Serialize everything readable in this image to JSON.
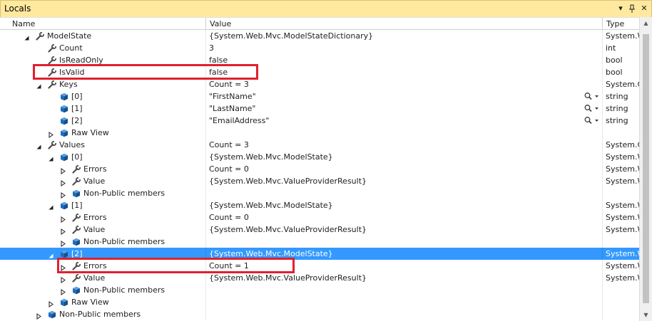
{
  "window": {
    "title": "Locals",
    "dropdown_glyph": "▾",
    "pin_glyph": "ᵖ",
    "close_glyph": "✕"
  },
  "columns": {
    "name": "Name",
    "value": "Value",
    "type": "Type"
  },
  "rows": [
    {
      "level": 2,
      "expander": "expanded",
      "icon": "wrench",
      "name": "ModelState",
      "value": "{System.Web.Mvc.ModelStateDictionary}",
      "type": "System.W",
      "magnifier": false,
      "selected": false
    },
    {
      "level": 3,
      "expander": "none",
      "icon": "wrench",
      "name": "Count",
      "value": "3",
      "type": "int",
      "magnifier": false,
      "selected": false
    },
    {
      "level": 3,
      "expander": "none",
      "icon": "wrench",
      "name": "IsReadOnly",
      "value": "false",
      "type": "bool",
      "magnifier": false,
      "selected": false
    },
    {
      "level": 3,
      "expander": "none",
      "icon": "wrench",
      "name": "IsValid",
      "value": "false",
      "type": "bool",
      "magnifier": false,
      "selected": false
    },
    {
      "level": 3,
      "expander": "expanded",
      "icon": "wrench",
      "name": "Keys",
      "value": "Count = 3",
      "type": "System.C",
      "magnifier": false,
      "selected": false
    },
    {
      "level": 4,
      "expander": "none",
      "icon": "cube",
      "name": "[0]",
      "value": "\"FirstName\"",
      "type": "string",
      "magnifier": true,
      "selected": false
    },
    {
      "level": 4,
      "expander": "none",
      "icon": "cube",
      "name": "[1]",
      "value": "\"LastName\"",
      "type": "string",
      "magnifier": true,
      "selected": false
    },
    {
      "level": 4,
      "expander": "none",
      "icon": "cube",
      "name": "[2]",
      "value": "\"EmailAddress\"",
      "type": "string",
      "magnifier": true,
      "selected": false
    },
    {
      "level": 4,
      "expander": "collapsed",
      "icon": "cube",
      "name": "Raw View",
      "value": "",
      "type": "",
      "magnifier": false,
      "selected": false
    },
    {
      "level": 3,
      "expander": "expanded",
      "icon": "wrench",
      "name": "Values",
      "value": "Count = 3",
      "type": "System.C",
      "magnifier": false,
      "selected": false
    },
    {
      "level": 4,
      "expander": "expanded",
      "icon": "cube",
      "name": "[0]",
      "value": "{System.Web.Mvc.ModelState}",
      "type": "System.W",
      "magnifier": false,
      "selected": false
    },
    {
      "level": 5,
      "expander": "collapsed",
      "icon": "wrench",
      "name": "Errors",
      "value": "Count = 0",
      "type": "System.W",
      "magnifier": false,
      "selected": false
    },
    {
      "level": 5,
      "expander": "collapsed",
      "icon": "wrench",
      "name": "Value",
      "value": "{System.Web.Mvc.ValueProviderResult}",
      "type": "System.W",
      "magnifier": false,
      "selected": false
    },
    {
      "level": 5,
      "expander": "collapsed",
      "icon": "cube",
      "name": "Non-Public members",
      "value": "",
      "type": "",
      "magnifier": false,
      "selected": false
    },
    {
      "level": 4,
      "expander": "expanded",
      "icon": "cube",
      "name": "[1]",
      "value": "{System.Web.Mvc.ModelState}",
      "type": "System.W",
      "magnifier": false,
      "selected": false
    },
    {
      "level": 5,
      "expander": "collapsed",
      "icon": "wrench",
      "name": "Errors",
      "value": "Count = 0",
      "type": "System.W",
      "magnifier": false,
      "selected": false
    },
    {
      "level": 5,
      "expander": "collapsed",
      "icon": "wrench",
      "name": "Value",
      "value": "{System.Web.Mvc.ValueProviderResult}",
      "type": "System.W",
      "magnifier": false,
      "selected": false
    },
    {
      "level": 5,
      "expander": "collapsed",
      "icon": "cube",
      "name": "Non-Public members",
      "value": "",
      "type": "",
      "magnifier": false,
      "selected": false
    },
    {
      "level": 4,
      "expander": "expanded",
      "icon": "cube",
      "name": "[2]",
      "value": "{System.Web.Mvc.ModelState}",
      "type": "System.W",
      "magnifier": false,
      "selected": true
    },
    {
      "level": 5,
      "expander": "collapsed",
      "icon": "wrench",
      "name": "Errors",
      "value": "Count = 1",
      "type": "System.W",
      "magnifier": false,
      "selected": false
    },
    {
      "level": 5,
      "expander": "collapsed",
      "icon": "wrench",
      "name": "Value",
      "value": "{System.Web.Mvc.ValueProviderResult}",
      "type": "System.W",
      "magnifier": false,
      "selected": false
    },
    {
      "level": 5,
      "expander": "collapsed",
      "icon": "cube",
      "name": "Non-Public members",
      "value": "",
      "type": "",
      "magnifier": false,
      "selected": false
    },
    {
      "level": 4,
      "expander": "collapsed",
      "icon": "cube",
      "name": "Raw View",
      "value": "",
      "type": "",
      "magnifier": false,
      "selected": false
    },
    {
      "level": 3,
      "expander": "collapsed",
      "icon": "cube",
      "name": "Non-Public members",
      "value": "",
      "type": "",
      "magnifier": false,
      "selected": false
    }
  ],
  "highlighted_rows": [
    3,
    19
  ],
  "colors": {
    "titlebar": "#ffe99e",
    "selection": "#3399ff",
    "highlight_box": "#e0202f",
    "wrench_icon": "#4d4d4d",
    "cube_icon": "#1e6bbd"
  },
  "scrollbar": {
    "up_glyph": "▲",
    "down_glyph": "▼"
  }
}
